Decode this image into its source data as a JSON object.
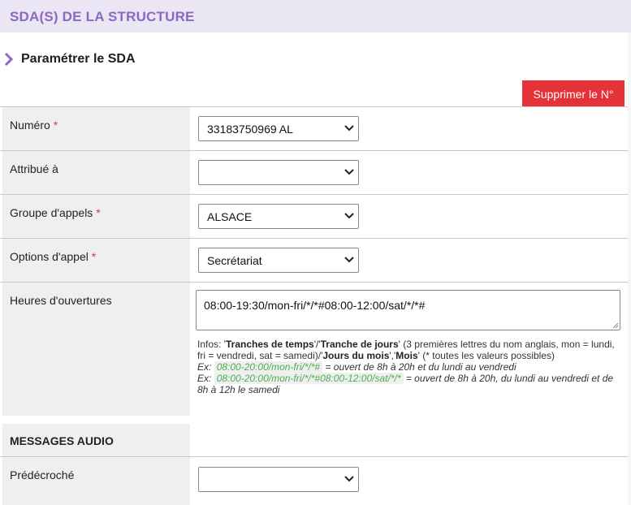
{
  "header": {
    "title": "SDA(S) DE LA STRUCTURE"
  },
  "section": {
    "title": "Paramétrer le SDA"
  },
  "actions": {
    "delete_label": "Supprimer le N°"
  },
  "form": {
    "numero": {
      "label": "Numéro",
      "required_mark": "*",
      "value": "33183750969 AL"
    },
    "attribue": {
      "label": "Attribué à",
      "value": ""
    },
    "groupe": {
      "label": "Groupe d'appels",
      "required_mark": "*",
      "value": "ALSACE"
    },
    "options": {
      "label": "Options d'appel",
      "required_mark": "*",
      "value": "Secrétariat"
    },
    "heures": {
      "label": "Heures d'ouvertures",
      "value": "08:00-19:30/mon-fri/*/*#08:00-12:00/sat/*/*#",
      "info": {
        "prefix": "Infos: '",
        "b1": "Tranches de temps",
        "s1": "'/'",
        "b2": "Tranche de jours",
        "s2": "' (3 premières lettres du nom anglais, mon = lundi, fri = vendredi, sat = samedi)/'",
        "b3": "Jours du mois",
        "s3": "','",
        "b4": "Mois",
        "s4": "' (* toutes les valeurs possibles)",
        "ex1_label": "Ex:",
        "ex1_code": "08:00-20:00/mon-fri/*/*#",
        "ex1_text": "= ouvert de 8h à 20h et du lundi au vendredi",
        "ex2_label": "Ex:",
        "ex2_code": "08:00-20:00/mon-fri/*/*#08:00-12:00/sat/*/*",
        "ex2_text": "= ouvert de 8h à 20h, du lundi au vendredi et de 8h à 12h le samedi"
      }
    }
  },
  "messages": {
    "title": "MESSAGES AUDIO",
    "predecroche": {
      "label": "Prédécroché",
      "value": ""
    }
  },
  "colors": {
    "accent": "#8b68c2",
    "header_bg": "#ebe6f4",
    "danger": "#e53238",
    "code": "#4caf50"
  },
  "icons": {
    "section": "chevron-right-icon",
    "select": "chevron-down-icon"
  }
}
